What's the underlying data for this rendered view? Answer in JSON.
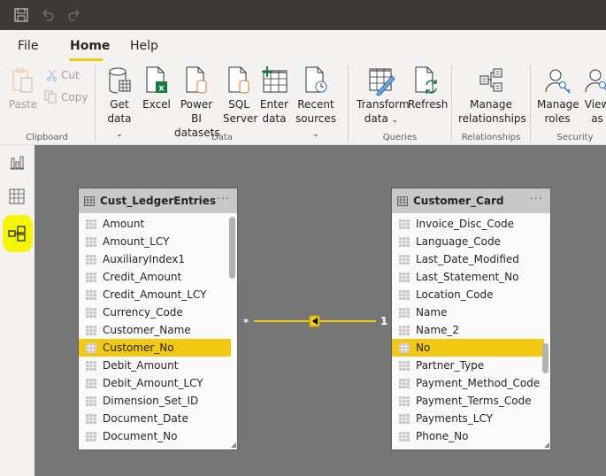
{
  "titlebar": {
    "icons": [
      "save-icon",
      "undo-icon",
      "redo-icon"
    ]
  },
  "menu": {
    "tabs": [
      {
        "label": "File"
      },
      {
        "label": "Home",
        "active": true
      },
      {
        "label": "Help"
      }
    ]
  },
  "ribbon": {
    "clipboard": {
      "paste": "Paste",
      "cut": "Cut",
      "copy": "Copy",
      "group": "Clipboard"
    },
    "data": {
      "get_data": [
        "Get",
        "data"
      ],
      "excel": "Excel",
      "powerbi": [
        "Power BI",
        "datasets"
      ],
      "sql": [
        "SQL",
        "Server"
      ],
      "enter": [
        "Enter",
        "data"
      ],
      "recent": [
        "Recent",
        "sources"
      ],
      "group": "Data"
    },
    "queries": {
      "transform": [
        "Transform",
        "data"
      ],
      "refresh": "Refresh",
      "group": "Queries"
    },
    "relationships": {
      "manage": [
        "Manage",
        "relationships"
      ],
      "group": "Relationships"
    },
    "security": {
      "manage_roles": [
        "Manage",
        "roles"
      ],
      "view_as": [
        "View",
        "as"
      ],
      "group": "Security"
    },
    "chevron": "⌄"
  },
  "sidebar": {
    "items": [
      "report-view",
      "data-view",
      "model-view"
    ],
    "active": "model-view",
    "highlight_color": "#f5f50a"
  },
  "model": {
    "left_table": {
      "title": "Cust_LedgerEntries",
      "more": "···",
      "fields": [
        "Amount",
        "Amount_LCY",
        "AuxiliaryIndex1",
        "Credit_Amount",
        "Credit_Amount_LCY",
        "Currency_Code",
        "Customer_Name",
        "Customer_No",
        "Debit_Amount",
        "Debit_Amount_LCY",
        "Dimension_Set_ID",
        "Document_Date",
        "Document_No"
      ],
      "selected": "Customer_No"
    },
    "right_table": {
      "title": "Customer_Card",
      "more": "···",
      "fields": [
        "Invoice_Disc_Code",
        "Language_Code",
        "Last_Date_Modified",
        "Last_Statement_No",
        "Location_Code",
        "Name",
        "Name_2",
        "No",
        "Partner_Type",
        "Payment_Method_Code",
        "Payment_Terms_Code",
        "Payments_LCY",
        "Phone_No"
      ],
      "selected": "No"
    },
    "relationship": {
      "from_cardinality": "*",
      "to_cardinality": "1",
      "color": "#f2c811"
    }
  }
}
